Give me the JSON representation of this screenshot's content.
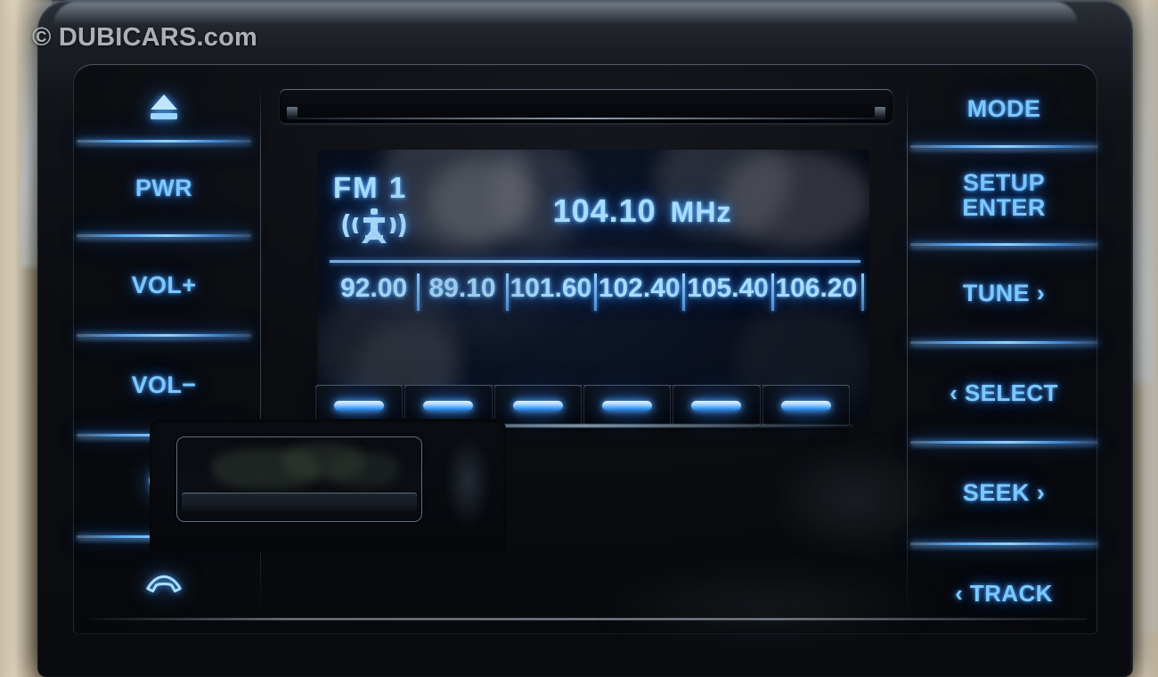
{
  "watermark": "© DUBICARS.com",
  "device": {
    "type": "car-audio-head-unit",
    "accent_color": "#7cc8ff",
    "glow_color": "#2f8ef0",
    "bezel_color": "#0b0d11",
    "trim_color": "#c9bda6"
  },
  "display": {
    "band": "FM 1",
    "frequency": "104.10",
    "unit": "MHz",
    "antenna_icon": "radio-tower-icon",
    "presets": [
      {
        "index": 1,
        "value": "92.00"
      },
      {
        "index": 2,
        "value": "89.10"
      },
      {
        "index": 3,
        "value": "101.60"
      },
      {
        "index": 4,
        "value": "102.40"
      },
      {
        "index": 5,
        "value": "105.40"
      },
      {
        "index": 6,
        "value": "106.20"
      }
    ]
  },
  "left_buttons": [
    {
      "label": "",
      "icon": "eject-icon",
      "name": "eject-button"
    },
    {
      "label": "PWR",
      "icon": "",
      "name": "power-button"
    },
    {
      "label": "VOL+",
      "icon": "",
      "name": "volume-up-button"
    },
    {
      "label": "VOL−",
      "icon": "",
      "name": "volume-down-button"
    },
    {
      "label": "",
      "icon": "phone-call-icon",
      "name": "phone-answer-button"
    },
    {
      "label": "",
      "icon": "phone-hangup-icon",
      "name": "phone-hangup-button"
    }
  ],
  "right_buttons": [
    {
      "label": "MODE",
      "name": "mode-button"
    },
    {
      "label": "SETUP\nENTER",
      "name": "setup-enter-button"
    },
    {
      "label": "TUNE ›",
      "name": "tune-button"
    },
    {
      "label": "‹ SELECT",
      "name": "select-button"
    },
    {
      "label": "SEEK ›",
      "name": "seek-button"
    },
    {
      "label": "‹ TRACK",
      "name": "track-button"
    }
  ],
  "preset_buttons": [
    {
      "index": 1,
      "name": "preset-button-1"
    },
    {
      "index": 2,
      "name": "preset-button-2"
    },
    {
      "index": 3,
      "name": "preset-button-3"
    },
    {
      "index": 4,
      "name": "preset-button-4"
    },
    {
      "index": 5,
      "name": "preset-button-5"
    },
    {
      "index": 6,
      "name": "preset-button-6"
    }
  ],
  "cd_slot": {
    "label": ""
  }
}
